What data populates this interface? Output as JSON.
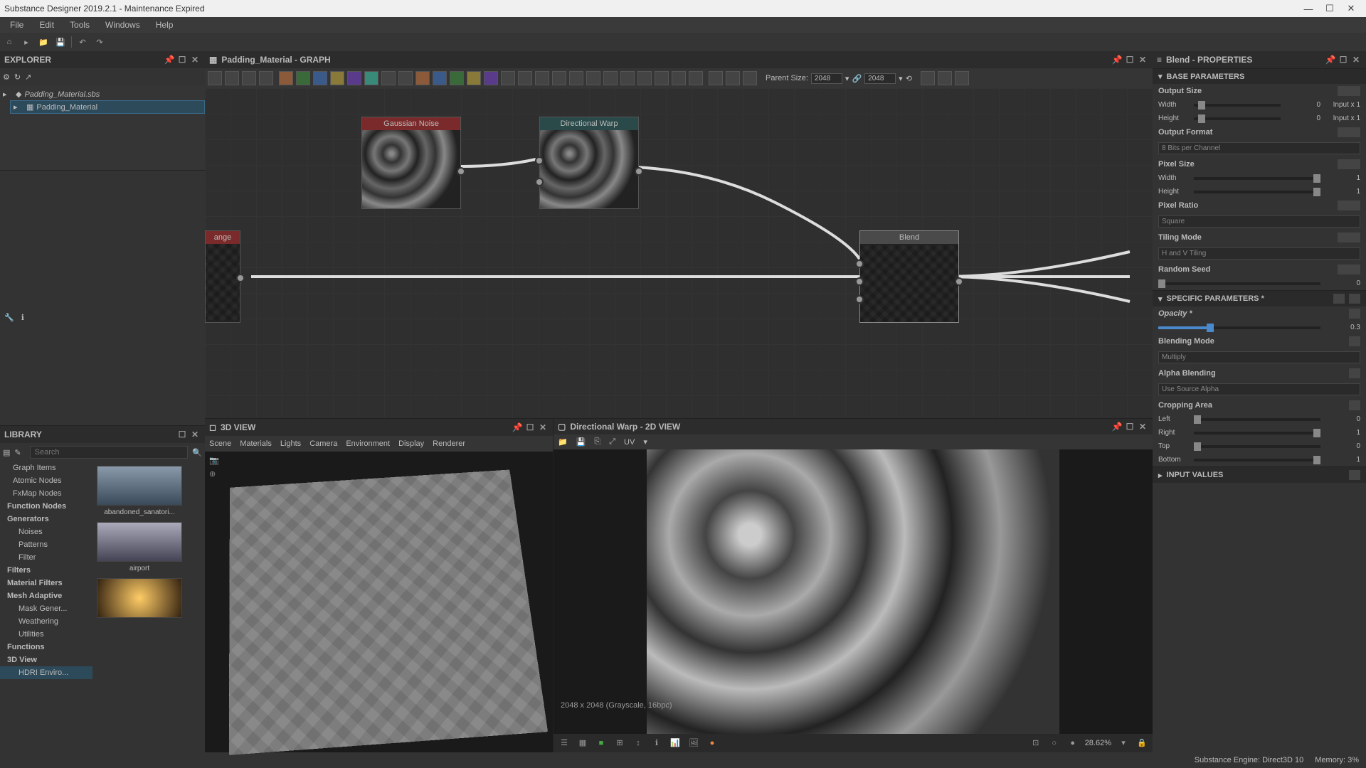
{
  "titlebar": {
    "title": "Substance Designer 2019.2.1 - Maintenance Expired"
  },
  "menubar": [
    "File",
    "Edit",
    "Tools",
    "Windows",
    "Help"
  ],
  "explorer": {
    "title": "EXPLORER",
    "file": "Padding_Material.sbs",
    "graph": "Padding_Material"
  },
  "library": {
    "title": "LIBRARY",
    "search_placeholder": "Search",
    "tree": [
      {
        "label": "Graph Items",
        "bold": false
      },
      {
        "label": "Atomic Nodes",
        "bold": false
      },
      {
        "label": "FxMap Nodes",
        "bold": false
      },
      {
        "label": "Function Nodes",
        "bold": true
      },
      {
        "label": "Generators",
        "bold": true
      },
      {
        "label": "Noises",
        "bold": false,
        "indent": true
      },
      {
        "label": "Patterns",
        "bold": false,
        "indent": true
      },
      {
        "label": "Filter",
        "bold": false,
        "indent": true
      },
      {
        "label": "Filters",
        "bold": true
      },
      {
        "label": "Material Filters",
        "bold": true
      },
      {
        "label": "Mesh Adaptive",
        "bold": true
      },
      {
        "label": "Mask Gener...",
        "bold": false,
        "indent": true
      },
      {
        "label": "Weathering",
        "bold": false,
        "indent": true
      },
      {
        "label": "Utilities",
        "bold": false,
        "indent": true
      },
      {
        "label": "Functions",
        "bold": true
      },
      {
        "label": "3D View",
        "bold": true
      },
      {
        "label": "HDRI Enviro...",
        "bold": false,
        "sel": true,
        "indent": true
      }
    ],
    "thumbs": [
      {
        "label": "abandoned_sanatori..."
      },
      {
        "label": "airport"
      },
      {
        "label": ""
      }
    ]
  },
  "graph": {
    "title": "Padding_Material - GRAPH",
    "parent_size_label": "Parent Size:",
    "parent_w": "2048",
    "parent_h": "2048",
    "nodes": {
      "partial": "ange",
      "gaussian": "Gaussian Noise",
      "warp": "Directional Warp",
      "blend": "Blend"
    }
  },
  "view3d": {
    "title": "3D VIEW",
    "menus": [
      "Scene",
      "Materials",
      "Lights",
      "Camera",
      "Environment",
      "Display",
      "Renderer"
    ]
  },
  "view2d": {
    "title": "Directional Warp - 2D VIEW",
    "uv_label": "UV",
    "info": "2048 x 2048 (Grayscale, 16bpc)",
    "zoom": "28.62%"
  },
  "properties": {
    "title": "Blend - PROPERTIES",
    "base_params": "BASE PARAMETERS",
    "output_size": "Output Size",
    "width_label": "Width",
    "height_label": "Height",
    "width_val": "0",
    "height_val": "0",
    "width_mode": "Input x 1",
    "height_mode": "Input x 1",
    "output_format": "Output Format",
    "output_format_val": "8 Bits per Channel",
    "pixel_size": "Pixel Size",
    "ps_width": "1",
    "ps_height": "1",
    "pixel_ratio": "Pixel Ratio",
    "pixel_ratio_val": "Square",
    "tiling_mode": "Tiling Mode",
    "tiling_mode_val": "H and V Tiling",
    "random_seed": "Random Seed",
    "random_seed_val": "0",
    "specific_params": "SPECIFIC PARAMETERS *",
    "opacity_label": "Opacity *",
    "opacity_val": "0.3",
    "blending_mode": "Blending Mode",
    "blending_mode_val": "Multiply",
    "alpha_blending": "Alpha Blending",
    "alpha_blending_val": "Use Source Alpha",
    "cropping_area": "Cropping Area",
    "crop_left": "Left",
    "crop_left_val": "0",
    "crop_right": "Right",
    "crop_right_val": "1",
    "crop_top": "Top",
    "crop_top_val": "0",
    "crop_bottom": "Bottom",
    "crop_bottom_val": "1",
    "input_values": "INPUT VALUES"
  },
  "statusbar": {
    "engine": "Substance Engine: Direct3D 10",
    "memory": "Memory: 3%"
  }
}
